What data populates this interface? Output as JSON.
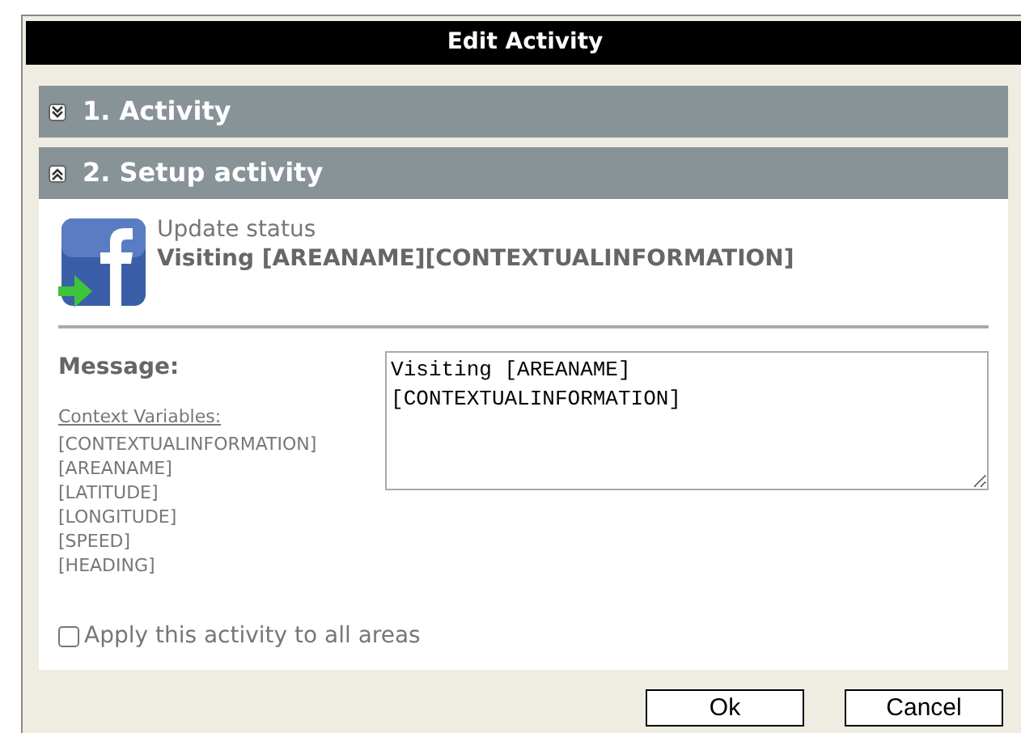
{
  "dialog": {
    "title": "Edit Activity"
  },
  "sections": [
    {
      "label": "1. Activity",
      "expanded": false
    },
    {
      "label": "2. Setup activity",
      "expanded": true
    }
  ],
  "activity": {
    "type": "Update status",
    "summary": "Visiting [AREANAME][CONTEXTUALINFORMATION]"
  },
  "message": {
    "label": "Message:",
    "variables_heading": "Context Variables:",
    "variables": [
      "[CONTEXTUALINFORMATION]",
      "[AREANAME]",
      "[LATITUDE]",
      "[LONGITUDE]",
      "[SPEED]",
      "[HEADING]"
    ],
    "value": "Visiting [AREANAME]\n[CONTEXTUALINFORMATION]"
  },
  "apply_all": {
    "label": "Apply this activity to all areas",
    "checked": false
  },
  "buttons": [
    "Ok",
    "Cancel"
  ]
}
